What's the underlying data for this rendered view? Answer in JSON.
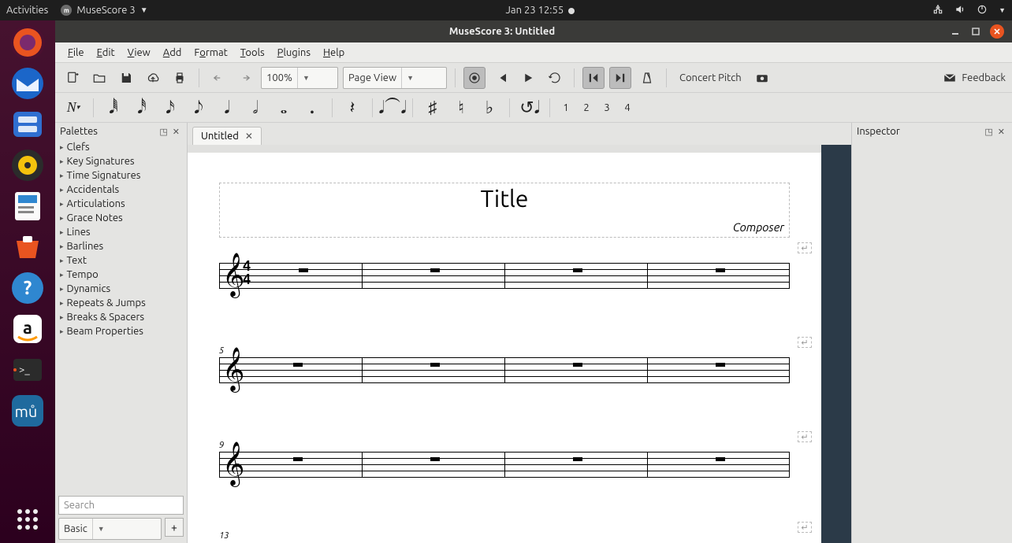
{
  "sysbar": {
    "activities": "Activities",
    "app_name": "MuseScore 3",
    "datetime": "Jan 23  12:55"
  },
  "window": {
    "title": "MuseScore 3: Untitled"
  },
  "menu": {
    "file": "File",
    "edit": "Edit",
    "view": "View",
    "add": "Add",
    "format": "Format",
    "tools": "Tools",
    "plugins": "Plugins",
    "help": "Help"
  },
  "toolbar": {
    "zoom": "100%",
    "view_mode": "Page View",
    "concert_pitch": "Concert Pitch",
    "feedback": "Feedback",
    "voices": [
      "1",
      "2",
      "3",
      "4"
    ]
  },
  "palettes": {
    "title": "Palettes",
    "items": [
      "Clefs",
      "Key Signatures",
      "Time Signatures",
      "Accidentals",
      "Articulations",
      "Grace Notes",
      "Lines",
      "Barlines",
      "Text",
      "Tempo",
      "Dynamics",
      "Repeats & Jumps",
      "Breaks & Spacers",
      "Beam Properties"
    ],
    "search_placeholder": "Search",
    "workspace": "Basic"
  },
  "tabs": {
    "doc": "Untitled"
  },
  "score": {
    "title": "Title",
    "composer": "Composer",
    "clef": "𝄞",
    "time_top": "4",
    "time_bottom": "4",
    "system_numbers": [
      "",
      "5",
      "9",
      "13"
    ]
  },
  "inspector": {
    "title": "Inspector"
  }
}
